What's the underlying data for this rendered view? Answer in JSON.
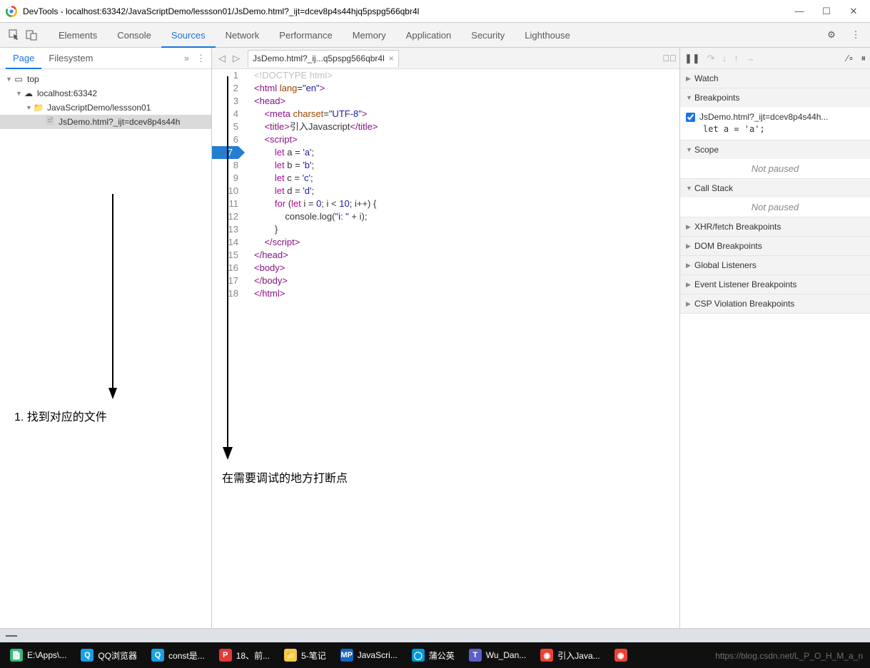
{
  "window": {
    "title": "DevTools - localhost:63342/JavaScriptDemo/lessson01/JsDemo.html?_ijt=dcev8p4s44hjq5pspg566qbr4l"
  },
  "main_tabs": [
    "Elements",
    "Console",
    "Sources",
    "Network",
    "Performance",
    "Memory",
    "Application",
    "Security",
    "Lighthouse"
  ],
  "main_active": "Sources",
  "left": {
    "tabs": [
      "Page",
      "Filesystem"
    ],
    "active": "Page",
    "tree": {
      "root": "top",
      "host": "localhost:63342",
      "folder": "JavaScriptDemo/lessson01",
      "file": "JsDemo.html?_ijt=dcev8p4s44h"
    },
    "annotation": "1. 找到对应的文件"
  },
  "editor": {
    "tab_name": "JsDemo.html?_ij...q5pspg566qbr4l",
    "breakpoint_line": 7,
    "lines": [
      {
        "n": 1,
        "html": "<span class='t-comment'>&lt;!DOCTYPE html&gt;</span>"
      },
      {
        "n": 2,
        "html": "<span class='t-tag'>&lt;html</span> <span class='t-attr'>lang</span>=<span class='t-str'>\"en\"</span><span class='t-tag'>&gt;</span>"
      },
      {
        "n": 3,
        "html": "<span class='t-tag'>&lt;head&gt;</span>"
      },
      {
        "n": 4,
        "html": "    <span class='t-tag'>&lt;meta</span> <span class='t-attr'>charset</span>=<span class='t-str'>\"UTF-8\"</span><span class='t-tag'>&gt;</span>"
      },
      {
        "n": 5,
        "html": "    <span class='t-tag'>&lt;title&gt;</span>引入Javascript<span class='t-tag'>&lt;/title&gt;</span>"
      },
      {
        "n": 6,
        "html": "    <span class='t-tag'>&lt;script&gt;</span>"
      },
      {
        "n": 7,
        "html": "        <span class='t-kw'>let</span> a = <span class='t-str'>'a'</span>;"
      },
      {
        "n": 8,
        "html": "        <span class='t-kw'>let</span> b = <span class='t-str'>'b'</span>;"
      },
      {
        "n": 9,
        "html": "        <span class='t-kw'>let</span> c = <span class='t-str'>'c'</span>;"
      },
      {
        "n": 10,
        "html": "        <span class='t-kw'>let</span> d = <span class='t-str'>'d'</span>;"
      },
      {
        "n": 11,
        "html": "        <span class='t-kw'>for</span> (<span class='t-kw'>let</span> i = <span class='t-num'>0</span>; i &lt; <span class='t-num'>10</span>; i++) {"
      },
      {
        "n": 12,
        "html": "            console.log(<span class='t-str'>\"i: \"</span> + i);"
      },
      {
        "n": 13,
        "html": "        }"
      },
      {
        "n": 14,
        "html": "    <span class='t-tag'>&lt;/script&gt;</span>"
      },
      {
        "n": 15,
        "html": "<span class='t-tag'>&lt;/head&gt;</span>"
      },
      {
        "n": 16,
        "html": "<span class='t-tag'>&lt;body&gt;</span>"
      },
      {
        "n": 17,
        "html": "<span class='t-tag'>&lt;/body&gt;</span>"
      },
      {
        "n": 18,
        "html": "<span class='t-tag'>&lt;/html&gt;</span>"
      }
    ],
    "annotation": "在需要调试的地方打断点"
  },
  "right": {
    "sections": {
      "watch": "Watch",
      "breakpoints": "Breakpoints",
      "scope": "Scope",
      "callstack": "Call Stack",
      "xhr": "XHR/fetch Breakpoints",
      "dom": "DOM Breakpoints",
      "global": "Global Listeners",
      "event": "Event Listener Breakpoints",
      "csp": "CSP Violation Breakpoints"
    },
    "breakpoint_item": {
      "label": "JsDemo.html?_ijt=dcev8p4s44h...",
      "code": "let a = 'a';"
    },
    "not_paused": "Not paused"
  },
  "taskbar": [
    {
      "icon": "📄",
      "color": "#3b7",
      "label": "E:\\Apps\\..."
    },
    {
      "icon": "Q",
      "color": "#17a0e6",
      "label": "QQ浏览器"
    },
    {
      "icon": "Q",
      "color": "#17a0e6",
      "label": "const是..."
    },
    {
      "icon": "P",
      "color": "#e53935",
      "label": "18、前..."
    },
    {
      "icon": "📁",
      "color": "#f7c948",
      "label": "5-笔记"
    },
    {
      "icon": "MP",
      "color": "#1565c0",
      "label": "JavaScri..."
    },
    {
      "icon": "◯",
      "color": "#0097d6",
      "label": "蒲公英"
    },
    {
      "icon": "T",
      "color": "#5b5fc7",
      "label": "Wu_Dan..."
    },
    {
      "icon": "◉",
      "color": "#ea4335",
      "label": "引入Java..."
    },
    {
      "icon": "◉",
      "color": "#ea4335",
      "label": ""
    }
  ],
  "watermark": "https://blog.csdn.net/L_P_O_H_M_a_n"
}
